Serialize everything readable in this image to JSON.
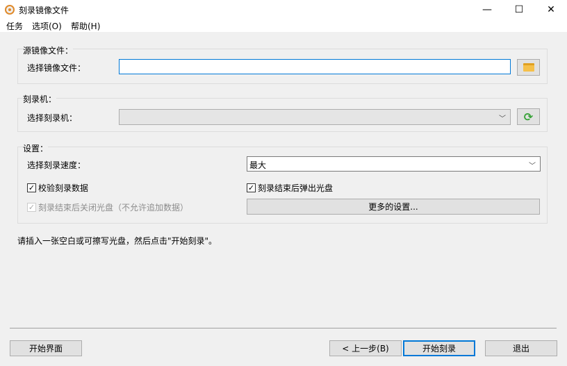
{
  "window": {
    "title": "刻录镜像文件",
    "minimize": "—",
    "maximize": "☐",
    "close": "✕"
  },
  "menu": [
    "任务",
    "选项(O)",
    "帮助(H)"
  ],
  "source": {
    "legend": "源镜像文件：",
    "label": "选择镜像文件：",
    "value": ""
  },
  "burner": {
    "legend": "刻录机：",
    "label": "选择刻录机：",
    "value": ""
  },
  "settings": {
    "legend": "设置：",
    "speed_label": "选择刻录速度：",
    "speed_value": "最大",
    "verify": "校验刻录数据",
    "eject": "刻录结束后弹出光盘",
    "finalize": "刻录结束后关闭光盘（不允许追加数据）",
    "more": "更多的设置..."
  },
  "info": "请插入一张空白或可擦写光盘，然后点击\"开始刻录\"。",
  "footer": {
    "home": "开始界面",
    "back": "< 上一步(B)",
    "start": "开始刻录",
    "exit": "退出"
  },
  "colors": {
    "focus": "#0078d7",
    "folder": "#f5c04a",
    "refresh": "#3aa33a"
  }
}
